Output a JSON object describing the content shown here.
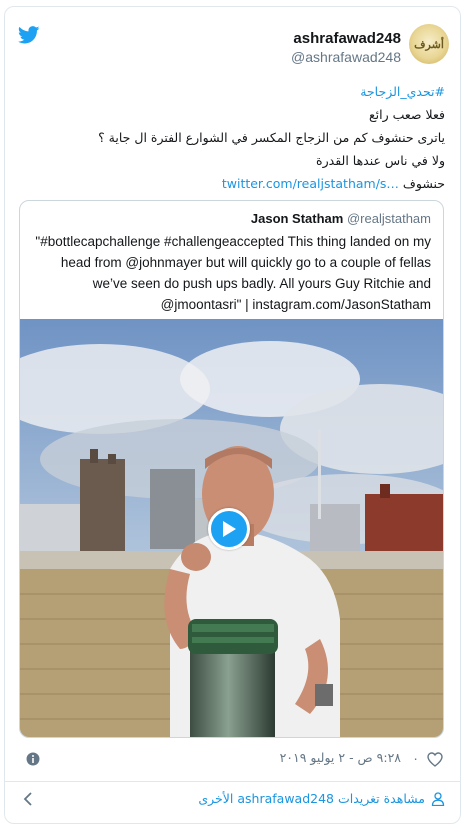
{
  "author": {
    "display_name": "ashrafawad248",
    "handle": "@ashrafawad248",
    "avatar_text": "أشرف"
  },
  "tweet": {
    "hashtag": "#تحدي_الزجاجة",
    "lines": [
      "فعلا صعب رائع",
      "ياترى حنشوف كم من الزجاج المكسر في الشوارع الفترة ال جاية ؟",
      "ولا في ناس عندها القدرة"
    ],
    "last_prefix": "حنشوف",
    "link": "twitter.com/realjstatham/s…"
  },
  "quote": {
    "name": "Jason Statham",
    "handle": "@realjstatham",
    "text": "\"#bottlecapchallenge #challengeaccepted This thing landed on my head from @johnmayer but will quickly go to a couple of fellas we’ve seen do push ups badly. All yours Guy Ritchie and @jmoontasri\" | instagram.com/JasonStatham"
  },
  "footer": {
    "like_count": "٠",
    "timestamp": "٩:٢٨ ص - ٢ يوليو ٢٠١٩",
    "more_link": "مشاهدة تغريدات ashrafawad248 الأخرى"
  },
  "colors": {
    "twitter_blue": "#1da1f2",
    "link_blue": "#1b95e0",
    "muted": "#657786"
  },
  "icons": [
    "twitter-bird-icon",
    "info-icon",
    "heart-icon",
    "person-icon",
    "chevron-left-icon",
    "play-icon"
  ]
}
